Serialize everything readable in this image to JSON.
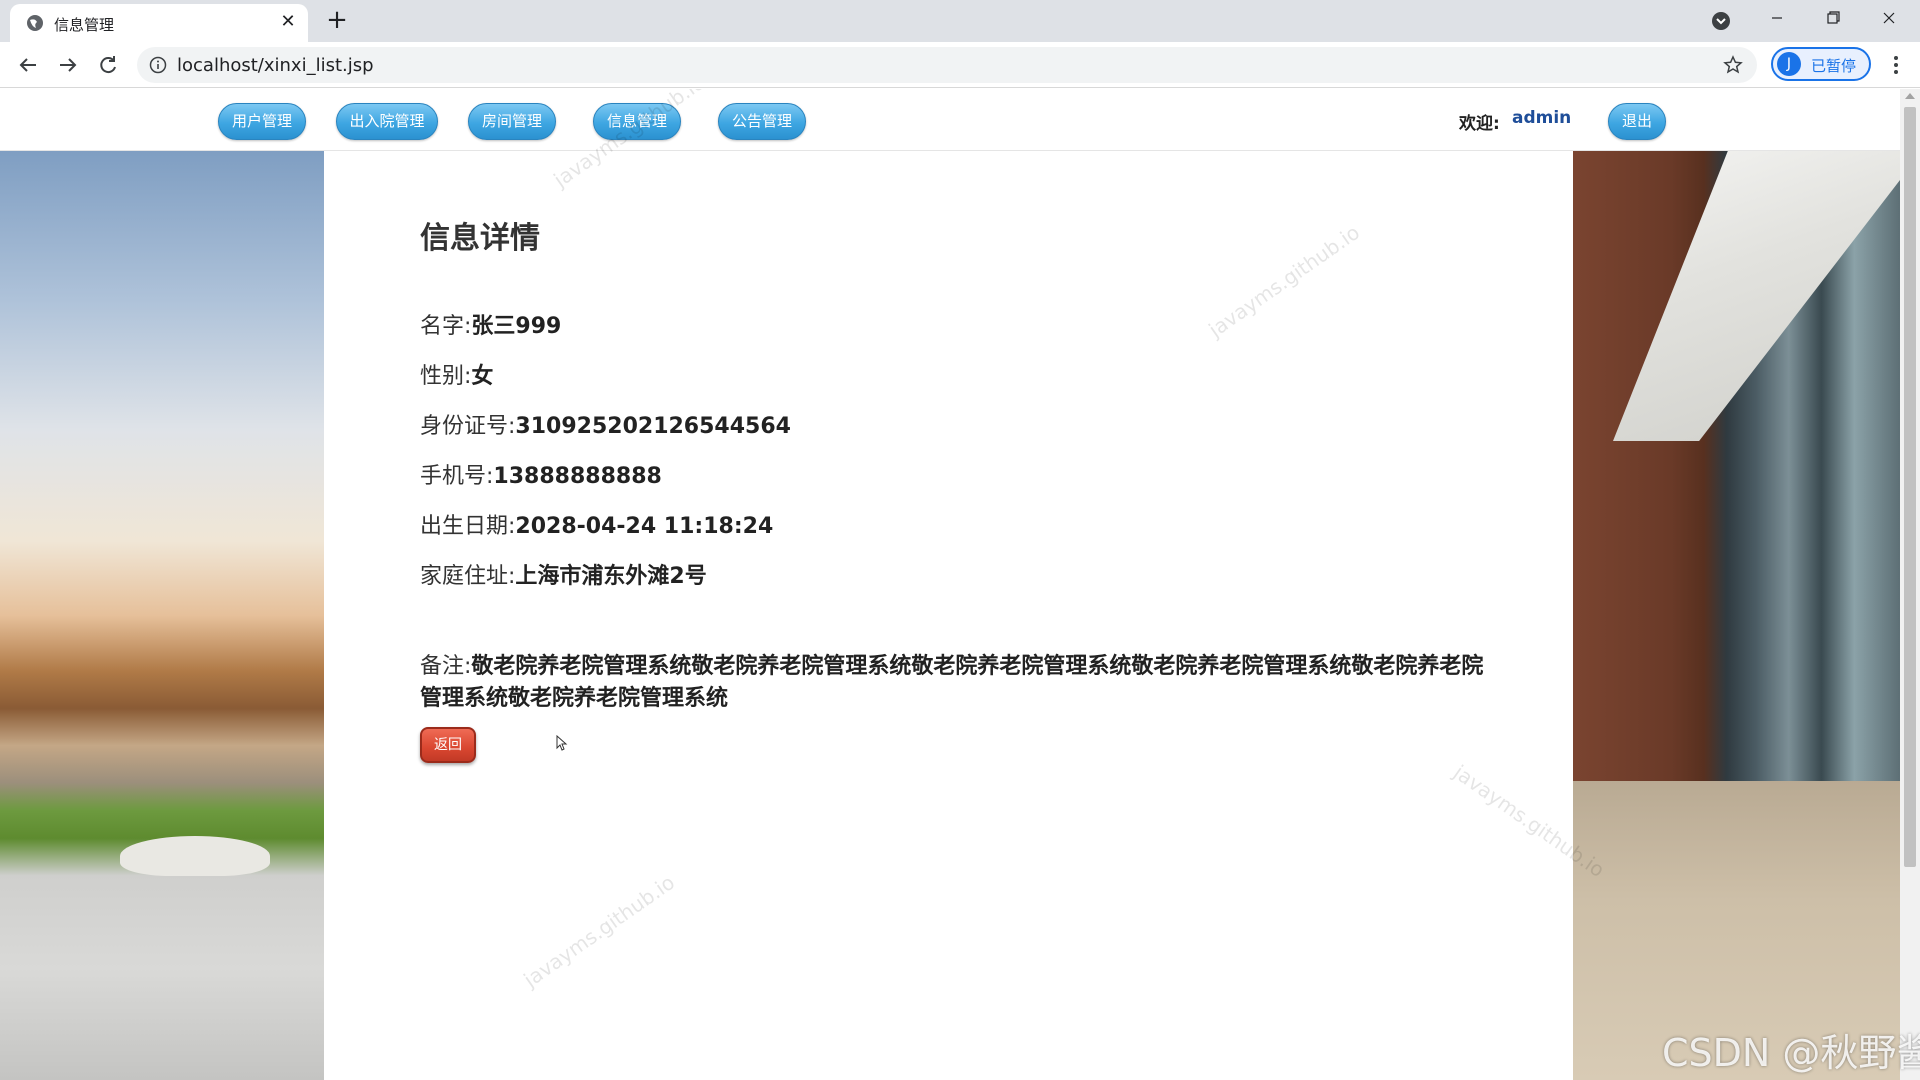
{
  "browser": {
    "tab_title": "信息管理",
    "url": "localhost/xinxi_list.jsp",
    "profile_initial": "J",
    "profile_label": "已暂停"
  },
  "nav": {
    "items": [
      "用户管理",
      "出入院管理",
      "房间管理",
      "信息管理",
      "公告管理"
    ],
    "welcome_label": "欢迎:",
    "welcome_user": "admin",
    "logout_label": "退出"
  },
  "detail": {
    "title": "信息详情",
    "name_label": "名字:",
    "name_value": "张三999",
    "gender_label": "性别:",
    "gender_value": "女",
    "id_label": "身份证号:",
    "id_value": "310925202126544564",
    "phone_label": "手机号:",
    "phone_value": "13888888888",
    "birth_label": "出生日期:",
    "birth_value": "2028-04-24 11:18:24",
    "address_label": "家庭住址:",
    "address_value": "上海市浦东外滩2号",
    "remark_label": "备注:",
    "remark_value": "敬老院养老院管理系统敬老院养老院管理系统敬老院养老院管理系统敬老院养老院管理系统敬老院养老院管理系统敬老院养老院管理系统",
    "back_label": "返回"
  },
  "watermarks": [
    "javayms.github.io",
    "javayms.github.io",
    "javayms.github.io",
    "javayms.github.io"
  ],
  "csdn_mark": "CSDN @秋野酱",
  "colors": {
    "nav_pill": "#3ea6e2",
    "back_button": "#d94630",
    "user_link": "#1f4e99"
  }
}
